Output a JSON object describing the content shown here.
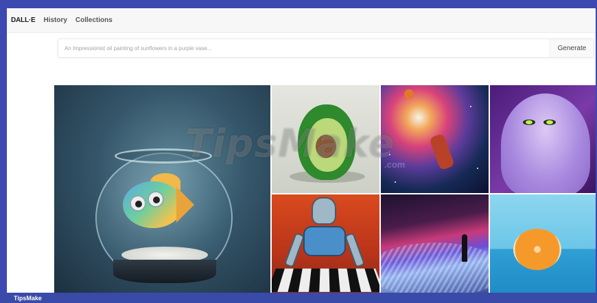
{
  "nav": {
    "brand": "DALL·E",
    "links": [
      "History",
      "Collections"
    ]
  },
  "prompt": {
    "placeholder": "An Impressionist oil painting of sunflowers in a purple vase...",
    "generate_label": "Generate"
  },
  "gallery": {
    "images": [
      {
        "name": "fishbowl"
      },
      {
        "name": "avocado-chair"
      },
      {
        "name": "space-basketball"
      },
      {
        "name": "purple-monster"
      },
      {
        "name": "robot-chess"
      },
      {
        "name": "neon-beach"
      },
      {
        "name": "orange-half"
      }
    ]
  },
  "watermark": {
    "text": "TipsMake",
    "suffix": ".com"
  },
  "footer": {
    "label": "TipsMake"
  }
}
